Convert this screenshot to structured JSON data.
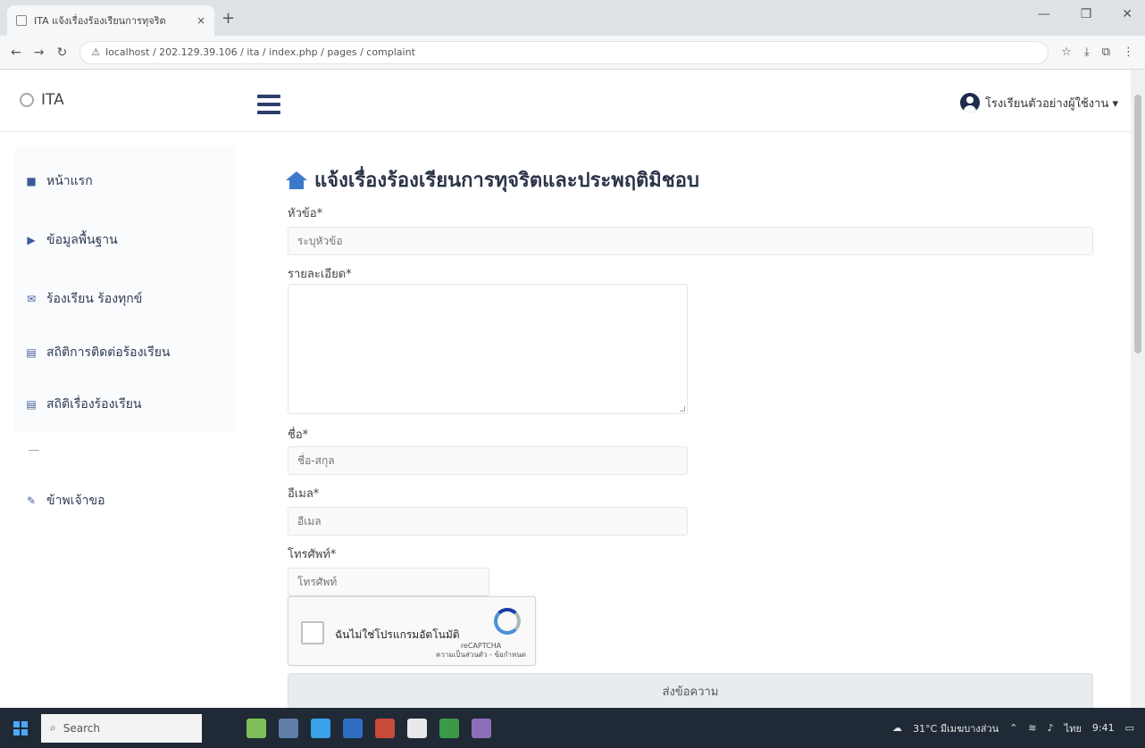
{
  "browser": {
    "tab_title": "ITA แจ้งเรื่องร้องเรียนการทุจริต",
    "tab_close": "×",
    "new_tab": "+",
    "url": "localhost / 202.129.39.106 / ita / index.php / pages / complaint",
    "window_controls": [
      "—",
      "❐",
      "✕"
    ],
    "toolbar_icons": [
      "☆",
      "⤓",
      "⧉",
      "⋮"
    ]
  },
  "app": {
    "brand": "ITA",
    "user_name": "โรงเรียนตัวอย่างผู้ใช้งาน ▾"
  },
  "sidebar": {
    "items": [
      {
        "icon": "home-icon",
        "glyph": "■",
        "label": "หน้าแรก"
      },
      {
        "icon": "folder-icon",
        "glyph": "▶",
        "label": "ข้อมูลพื้นฐาน"
      },
      {
        "icon": "bullhorn-icon",
        "glyph": "✉",
        "label": "ร้องเรียน ร้องทุกข์"
      },
      {
        "icon": "chart-icon",
        "glyph": "▤",
        "label": "สถิติการติดต่อร้องเรียน"
      },
      {
        "icon": "chart-icon-2",
        "glyph": "▤",
        "label": "สถิติเรื่องร้องเรียน"
      },
      {
        "icon": "key-icon",
        "glyph": "✎",
        "label": "ข้าพเจ้าขอ"
      }
    ]
  },
  "form": {
    "title": "แจ้งเรื่องร้องเรียนการทุจริตและประพฤติมิชอบ",
    "subject_label": "หัวข้อ*",
    "subject_placeholder": "ระบุหัวข้อ",
    "detail_label": "รายละเอียด*",
    "name_label": "ชื่อ*",
    "name_placeholder": "ชื่อ-สกุล",
    "email_label": "อีเมล*",
    "email_placeholder": "อีเมล",
    "phone_label": "โทรศัพท์*",
    "phone_placeholder": "โทรศัพท์",
    "captcha_label": "ฉันไม่ใช่โปรแกรมอัตโนมัติ",
    "captcha_brand": "reCAPTCHA",
    "captcha_terms": "ความเป็นส่วนตัว - ข้อกำหนด",
    "submit_label": "ส่งข้อความ"
  },
  "taskbar": {
    "search_placeholder": "Search",
    "weather": "31°C มีเมฆบางส่วน",
    "tray_lang": "ไทย",
    "clock": "9:41"
  }
}
